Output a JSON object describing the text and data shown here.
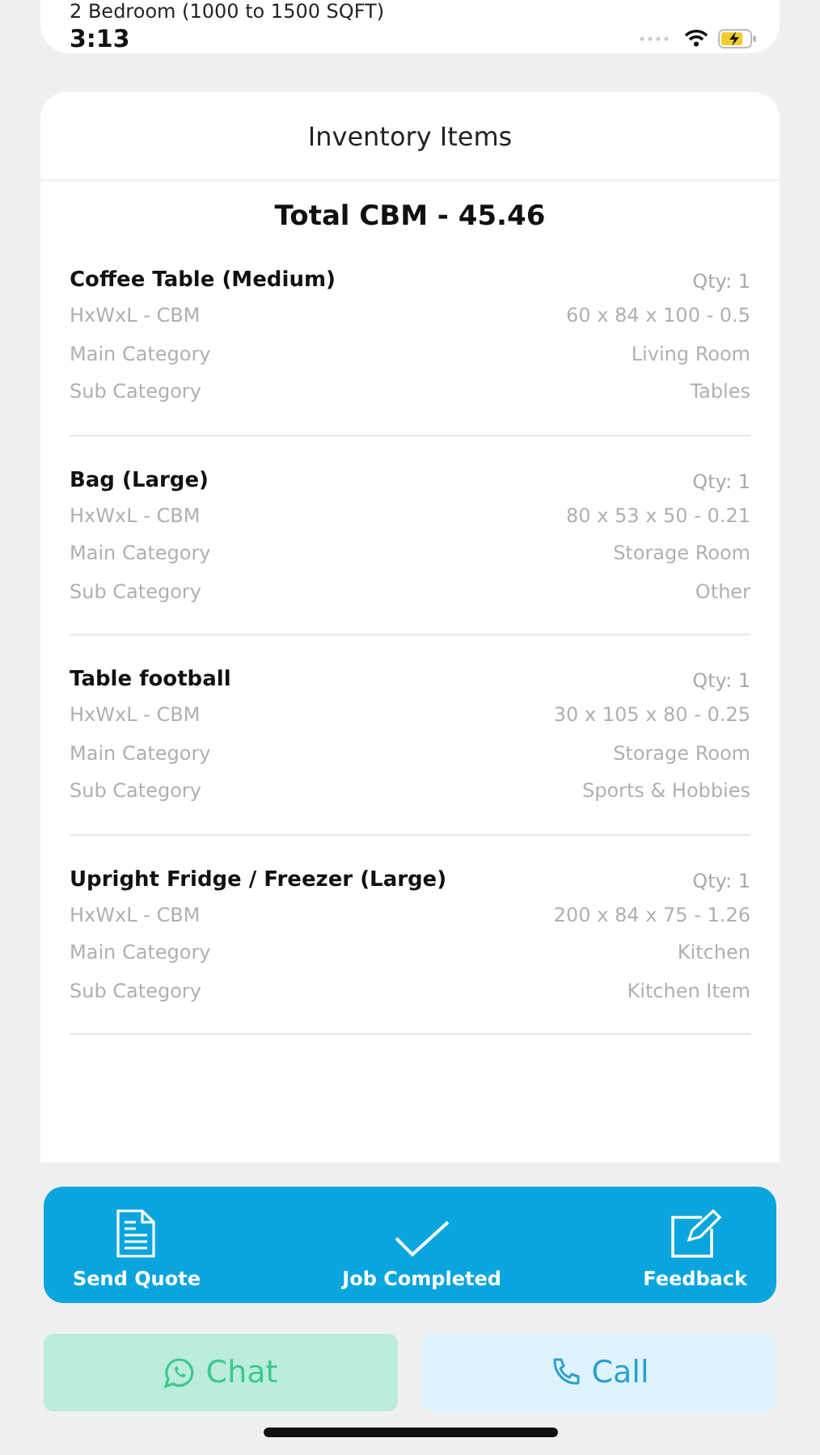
{
  "header": {
    "text": "2 Bedroom (1000 to 1500 SQFT)"
  },
  "status_bar": {
    "time": "3:13"
  },
  "inventory": {
    "title": "Inventory Items",
    "total": "Total CBM - 45.46",
    "items": [
      {
        "name": "Coffee Table (Medium)",
        "qty": "Qty: 1",
        "rows": [
          {
            "label": "HxWxL - CBM",
            "value": "60 x 84 x 100 - 0.5"
          },
          {
            "label": "Main Category",
            "value": "Living Room"
          },
          {
            "label": "Sub Category",
            "value": "Tables"
          }
        ]
      },
      {
        "name": "Bag (Large)",
        "qty": "Qty: 1",
        "rows": [
          {
            "label": "HxWxL - CBM",
            "value": "80 x 53 x 50 - 0.21"
          },
          {
            "label": "Main Category",
            "value": "Storage Room"
          },
          {
            "label": "Sub Category",
            "value": "Other"
          }
        ]
      },
      {
        "name": "Table football",
        "qty": "Qty: 1",
        "rows": [
          {
            "label": "HxWxL - CBM",
            "value": "30 x 105 x 80 - 0.25"
          },
          {
            "label": "Main Category",
            "value": "Storage Room"
          },
          {
            "label": "Sub Category",
            "value": "Sports & Hobbies"
          }
        ]
      },
      {
        "name": "Upright Fridge / Freezer (Large)",
        "qty": "Qty: 1",
        "rows": [
          {
            "label": "HxWxL - CBM",
            "value": "200 x 84 x 75 - 1.26"
          },
          {
            "label": "Main Category",
            "value": "Kitchen"
          },
          {
            "label": "Sub Category",
            "value": "Kitchen Item"
          }
        ]
      }
    ]
  },
  "actions": [
    {
      "kind": "document",
      "label": "Send Quote"
    },
    {
      "kind": "check",
      "label": "Job Completed"
    },
    {
      "kind": "edit",
      "label": "Feedback"
    }
  ],
  "contact_buttons": [
    {
      "kind": "chat",
      "label": "Chat"
    },
    {
      "kind": "call",
      "label": "Call"
    }
  ]
}
